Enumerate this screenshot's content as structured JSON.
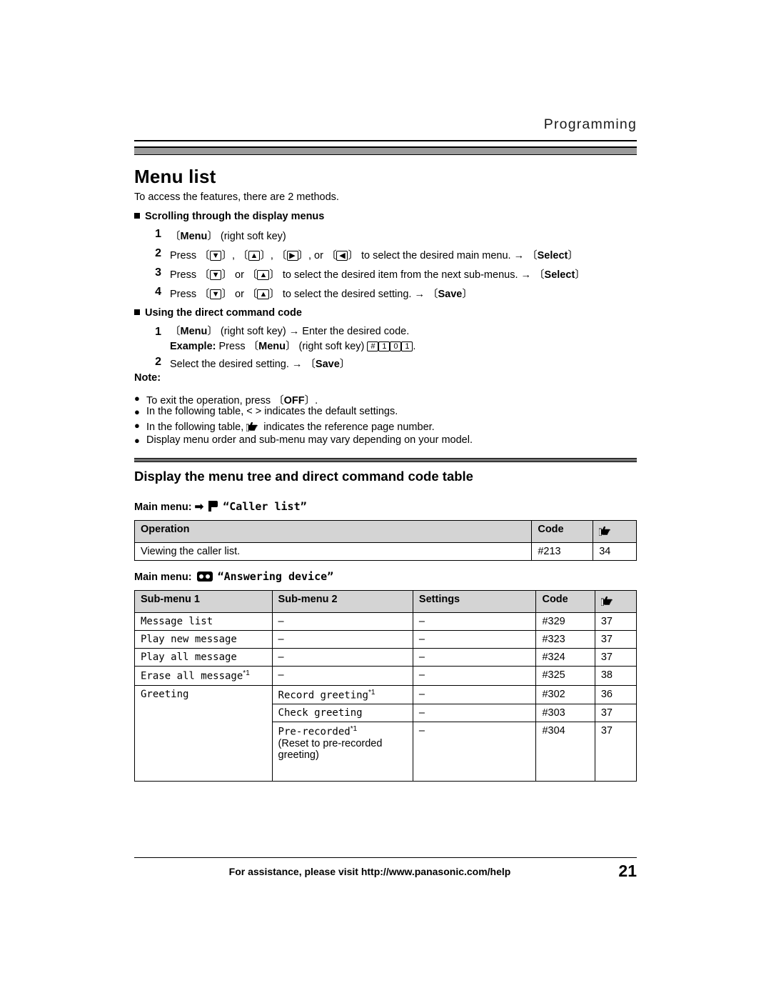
{
  "header": {
    "section": "Programming"
  },
  "title": "Menu list",
  "intro": "To access the features, there are 2 methods.",
  "method1": {
    "heading": "Scrolling through the display menus",
    "steps": [
      {
        "num": "1",
        "html": "〔<b class=\"k\">Menu</b>〕 (right soft key)"
      },
      {
        "num": "2",
        "html": "Press 〔<span class=\"key\">▼</span>〕, 〔<span class=\"key\">▲</span>〕, 〔<span class=\"key\">▶</span>〕, or 〔<span class=\"key\">◀</span>〕 to select the desired main menu. <span class=\"arr\">→</span> 〔<b class=\"k\">Select</b>〕"
      },
      {
        "num": "3",
        "html": "Press 〔<span class=\"key\">▼</span>〕 or 〔<span class=\"key\">▲</span>〕 to select the desired item from the next sub-menus. <span class=\"arr\">→</span> 〔<b class=\"k\">Select</b>〕"
      },
      {
        "num": "4",
        "html": "Press 〔<span class=\"key\">▼</span>〕 or 〔<span class=\"key\">▲</span>〕 to select the desired setting. <span class=\"arr\">→</span> 〔<b class=\"k\">Save</b>〕"
      }
    ]
  },
  "method2": {
    "heading": "Using the direct command code",
    "steps": [
      {
        "num": "1",
        "html": "〔<b class=\"k\">Menu</b>〕 (right soft key) <span class=\"arr\">→</span> Enter the desired code.<br><b class=\"k\">Example:</b> Press 〔<b class=\"k\">Menu</b>〕 (right soft key) <span class=\"key\">#</span><span class=\"key\">1</span><span class=\"key\">0</span><span class=\"key\">1</span>."
      },
      {
        "num": "2",
        "html": "Select the desired setting. <span class=\"arr\">→</span> 〔<b class=\"k\">Save</b>〕"
      }
    ]
  },
  "note": {
    "label": "Note:",
    "items": [
      "To exit the operation, press 〔OFF〕.",
      "In the following table, < > indicates the default settings.",
      "In the following table, [hand-icon] indicates the reference page number.",
      "Display menu order and sub-menu may vary depending on your model."
    ]
  },
  "section2": {
    "title": "Display the menu tree and direct command code table"
  },
  "caller_list": {
    "main_menu_label": "Main menu:",
    "icon": "phonebook-flag-icon",
    "menu_name": "“Caller list”",
    "headers": [
      "Operation",
      "Code",
      "ref-page-icon"
    ],
    "rows": [
      {
        "operation": "Viewing the caller list.",
        "code": "#213",
        "page": "34"
      }
    ]
  },
  "answering_device": {
    "main_menu_label": "Main menu:",
    "icon": "answering-device-icon",
    "menu_name": "“Answering device”",
    "headers": [
      "Sub-menu 1",
      "Sub-menu 2",
      "Settings",
      "Code",
      "ref-page-icon"
    ],
    "rows": [
      {
        "sub1": "Message list",
        "sub1_star": "",
        "sub2": "",
        "sub2_star": "",
        "sub2_note": "",
        "settings": "–",
        "dash1": "–",
        "code": "#329",
        "page": "37"
      },
      {
        "sub1": "Play new message",
        "sub1_star": "",
        "sub2": "",
        "sub2_star": "",
        "sub2_note": "",
        "settings": "–",
        "dash1": "–",
        "code": "#323",
        "page": "37"
      },
      {
        "sub1": "Play all message",
        "sub1_star": "",
        "sub2": "",
        "sub2_star": "",
        "sub2_note": "",
        "settings": "–",
        "dash1": "–",
        "code": "#324",
        "page": "37"
      },
      {
        "sub1": "Erase all message",
        "sub1_star": "*1",
        "sub2": "",
        "sub2_star": "",
        "sub2_note": "",
        "settings": "–",
        "dash1": "–",
        "code": "#325",
        "page": "38"
      },
      {
        "sub1": "Greeting",
        "sub1_star": "",
        "sub2": "Record greeting",
        "sub2_star": "*1",
        "sub2_note": "",
        "settings": "–",
        "dash1": "",
        "code": "#302",
        "page": "36"
      },
      {
        "sub1": "",
        "sub1_star": "",
        "sub2": "Check greeting",
        "sub2_star": "",
        "sub2_note": "",
        "settings": "–",
        "dash1": "",
        "code": "#303",
        "page": "37"
      },
      {
        "sub1": "",
        "sub1_star": "",
        "sub2": "Pre-recorded",
        "sub2_star": "*1",
        "sub2_note": "(Reset to pre-recorded greeting)",
        "settings": "–",
        "dash1": "",
        "code": "#304",
        "page": "37"
      }
    ]
  },
  "footer": {
    "text": "For assistance, please visit http://www.panasonic.com/help",
    "page": "21"
  }
}
